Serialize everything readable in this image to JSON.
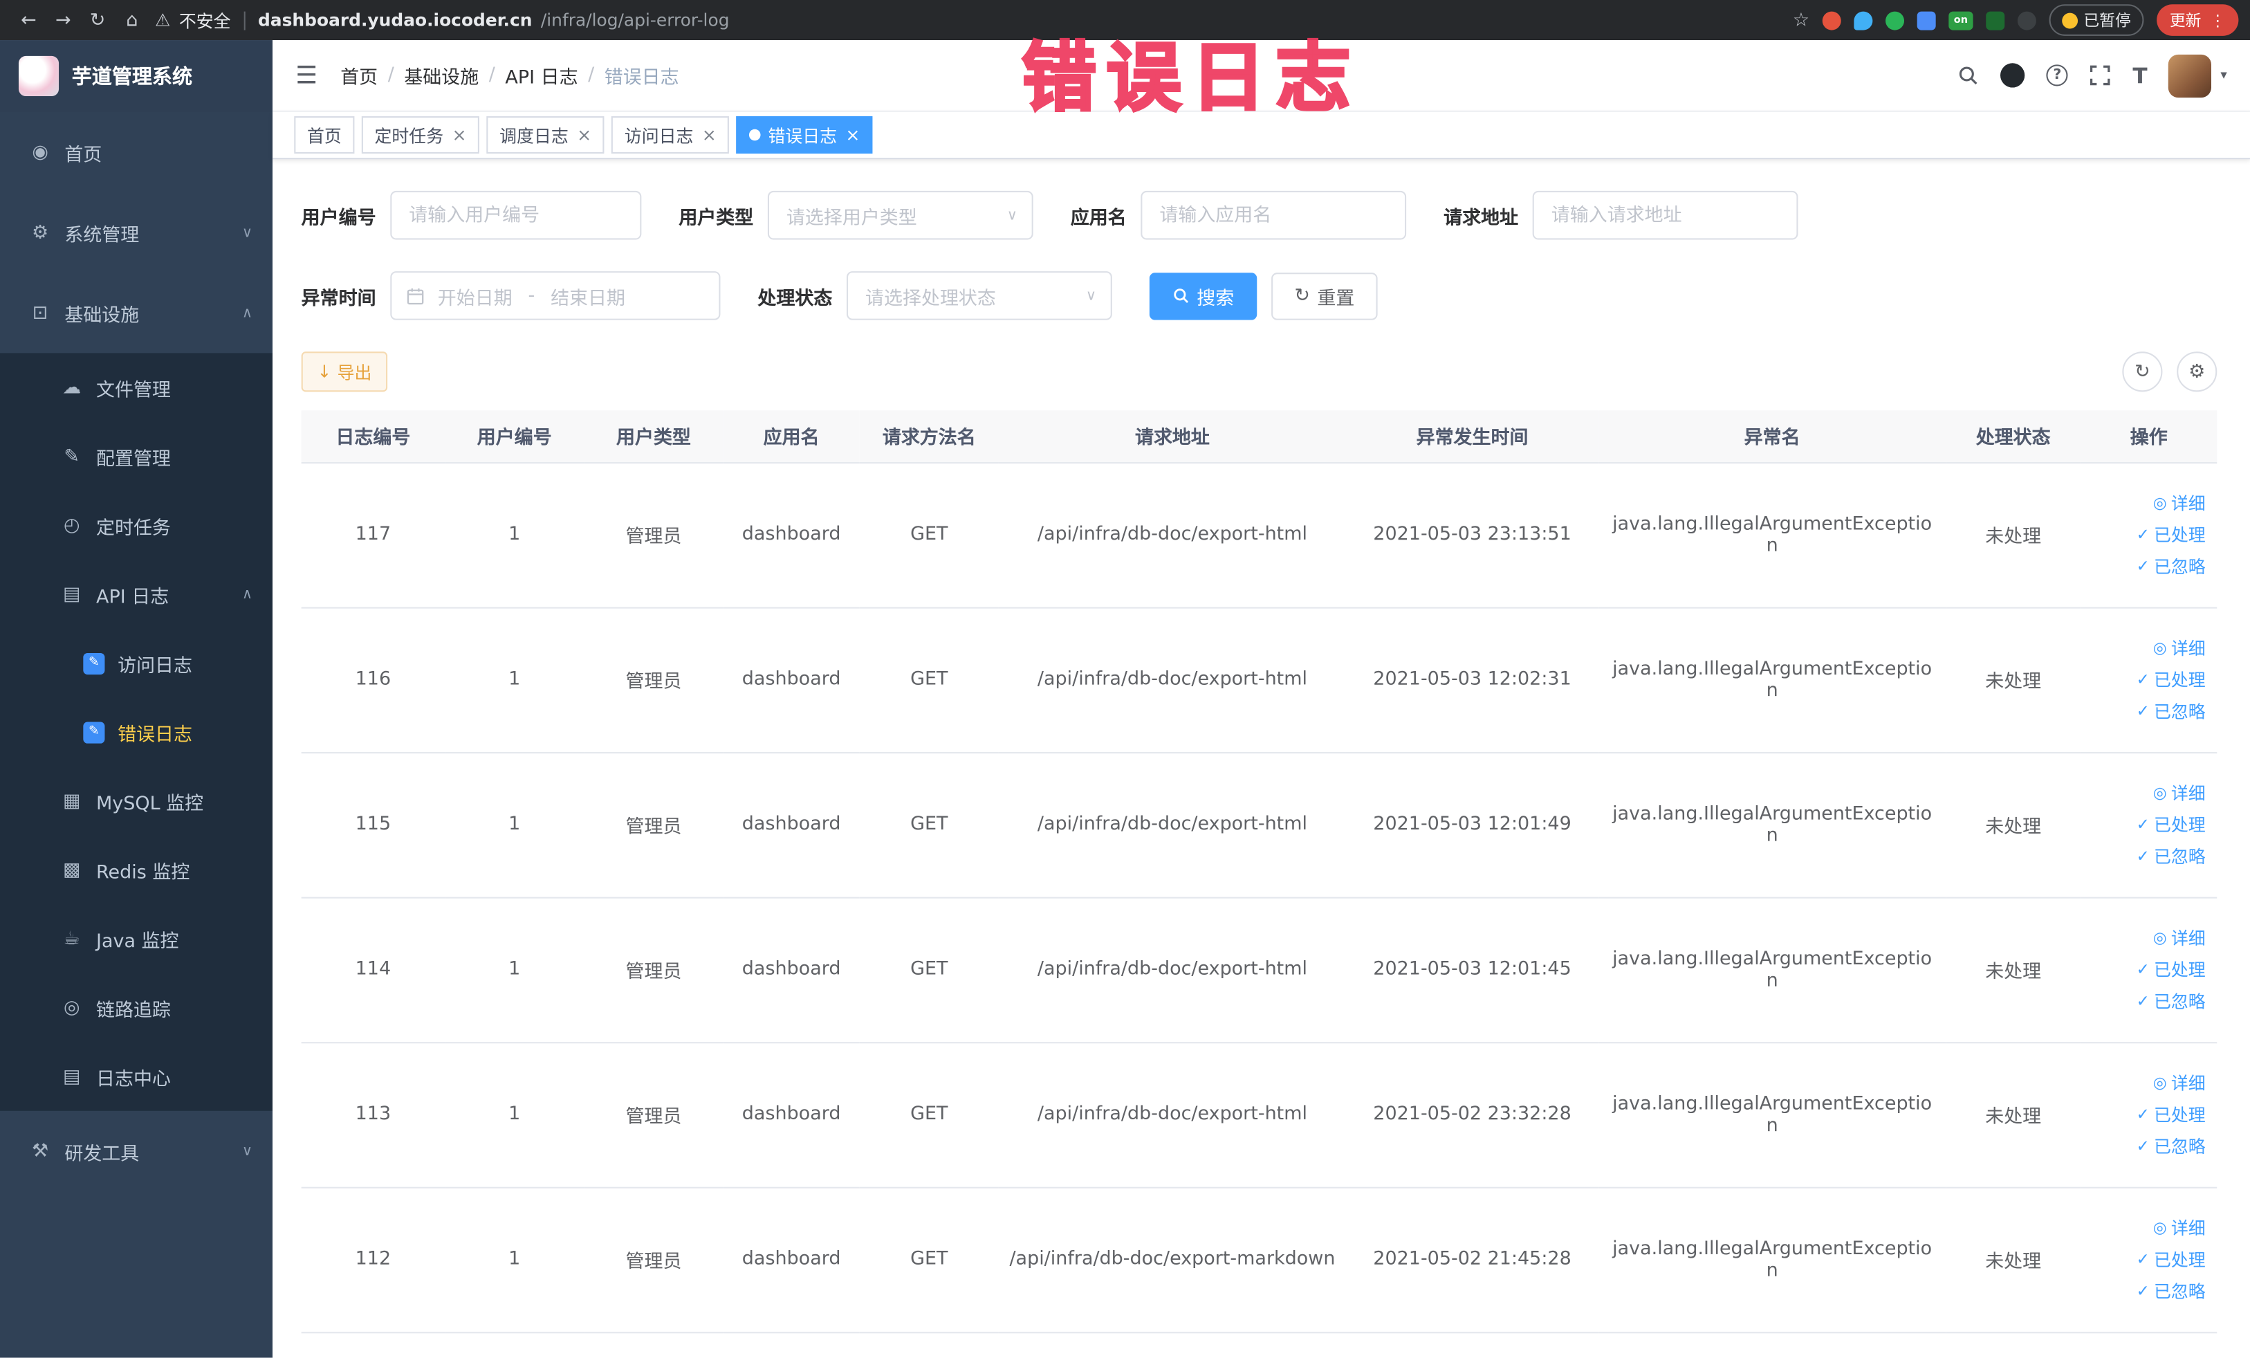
{
  "annotation": {
    "text": "错误日志"
  },
  "icons": {
    "back": "←",
    "forward": "→",
    "reload": "↻",
    "home": "⌂",
    "warning": "⚠",
    "star": "☆",
    "more": "⋮",
    "hamburger": "☰",
    "slash": "/",
    "question": "?",
    "caret": "▾",
    "chevron_down": "∨",
    "chevron_up": "∧",
    "close": "×",
    "download": "↓",
    "gear": "⚙",
    "view": "◎",
    "check": "✓",
    "font": "T",
    "dashboard": "◉",
    "monitor": "⊡",
    "cloud": "☁",
    "edit": "✎",
    "clock": "◴",
    "doc": "▤",
    "pencil": "✎",
    "grid": "▦",
    "stack": "▩",
    "cup": "☕",
    "target": "◎",
    "tools": "⚒"
  },
  "browser": {
    "security_label": "不安全",
    "url_domain": "dashboard.yudao.iocoder.cn",
    "url_path": "/infra/log/api-error-log",
    "ext_on_label": "on",
    "paused_label": "已暂停",
    "update_label": "更新"
  },
  "sidebar": {
    "logo_title": "芋道管理系统",
    "items": [
      {
        "label": "首页"
      },
      {
        "label": "系统管理"
      },
      {
        "label": "基础设施"
      },
      {
        "label": "文件管理"
      },
      {
        "label": "配置管理"
      },
      {
        "label": "定时任务"
      },
      {
        "label": "API 日志"
      },
      {
        "label": "访问日志"
      },
      {
        "label": "错误日志"
      },
      {
        "label": "MySQL 监控"
      },
      {
        "label": "Redis 监控"
      },
      {
        "label": "Java 监控"
      },
      {
        "label": "链路追踪"
      },
      {
        "label": "日志中心"
      },
      {
        "label": "研发工具"
      }
    ]
  },
  "header": {
    "breadcrumb": [
      "首页",
      "基础设施",
      "API 日志",
      "错误日志"
    ]
  },
  "tabs": [
    {
      "label": "首页"
    },
    {
      "label": "定时任务"
    },
    {
      "label": "调度日志"
    },
    {
      "label": "访问日志"
    },
    {
      "label": "错误日志"
    }
  ],
  "filters": {
    "user_id": {
      "label": "用户编号",
      "placeholder": "请输入用户编号"
    },
    "user_type": {
      "label": "用户类型",
      "placeholder": "请选择用户类型"
    },
    "app_name": {
      "label": "应用名",
      "placeholder": "请输入应用名"
    },
    "request_url": {
      "label": "请求地址",
      "placeholder": "请输入请求地址"
    },
    "exception_time": {
      "label": "异常时间",
      "start_placeholder": "开始日期",
      "separator": "-",
      "end_placeholder": "结束日期"
    },
    "process_status": {
      "label": "处理状态",
      "placeholder": "请选择处理状态"
    },
    "search_label": "搜索",
    "reset_label": "重置"
  },
  "toolbar": {
    "export_label": "导出"
  },
  "table": {
    "columns": [
      "日志编号",
      "用户编号",
      "用户类型",
      "应用名",
      "请求方法名",
      "请求地址",
      "异常发生时间",
      "异常名",
      "处理状态",
      "操作"
    ],
    "actions": {
      "detail": "详细",
      "processed": "已处理",
      "ignored": "已忽略"
    },
    "rows": [
      {
        "log_id": "117",
        "user_id": "1",
        "user_type": "管理员",
        "app_name": "dashboard",
        "method": "GET",
        "url": "/api/infra/db-doc/export-html",
        "time": "2021-05-03 23:13:51",
        "exception": "java.lang.IllegalArgumentException",
        "status": "未处理"
      },
      {
        "log_id": "116",
        "user_id": "1",
        "user_type": "管理员",
        "app_name": "dashboard",
        "method": "GET",
        "url": "/api/infra/db-doc/export-html",
        "time": "2021-05-03 12:02:31",
        "exception": "java.lang.IllegalArgumentException",
        "status": "未处理"
      },
      {
        "log_id": "115",
        "user_id": "1",
        "user_type": "管理员",
        "app_name": "dashboard",
        "method": "GET",
        "url": "/api/infra/db-doc/export-html",
        "time": "2021-05-03 12:01:49",
        "exception": "java.lang.IllegalArgumentException",
        "status": "未处理"
      },
      {
        "log_id": "114",
        "user_id": "1",
        "user_type": "管理员",
        "app_name": "dashboard",
        "method": "GET",
        "url": "/api/infra/db-doc/export-html",
        "time": "2021-05-03 12:01:45",
        "exception": "java.lang.IllegalArgumentException",
        "status": "未处理"
      },
      {
        "log_id": "113",
        "user_id": "1",
        "user_type": "管理员",
        "app_name": "dashboard",
        "method": "GET",
        "url": "/api/infra/db-doc/export-html",
        "time": "2021-05-02 23:32:28",
        "exception": "java.lang.IllegalArgumentException",
        "status": "未处理"
      },
      {
        "log_id": "112",
        "user_id": "1",
        "user_type": "管理员",
        "app_name": "dashboard",
        "method": "GET",
        "url": "/api/infra/db-doc/export-markdown",
        "time": "2021-05-02 21:45:28",
        "exception": "java.lang.IllegalArgumentException",
        "status": "未处理"
      }
    ]
  }
}
